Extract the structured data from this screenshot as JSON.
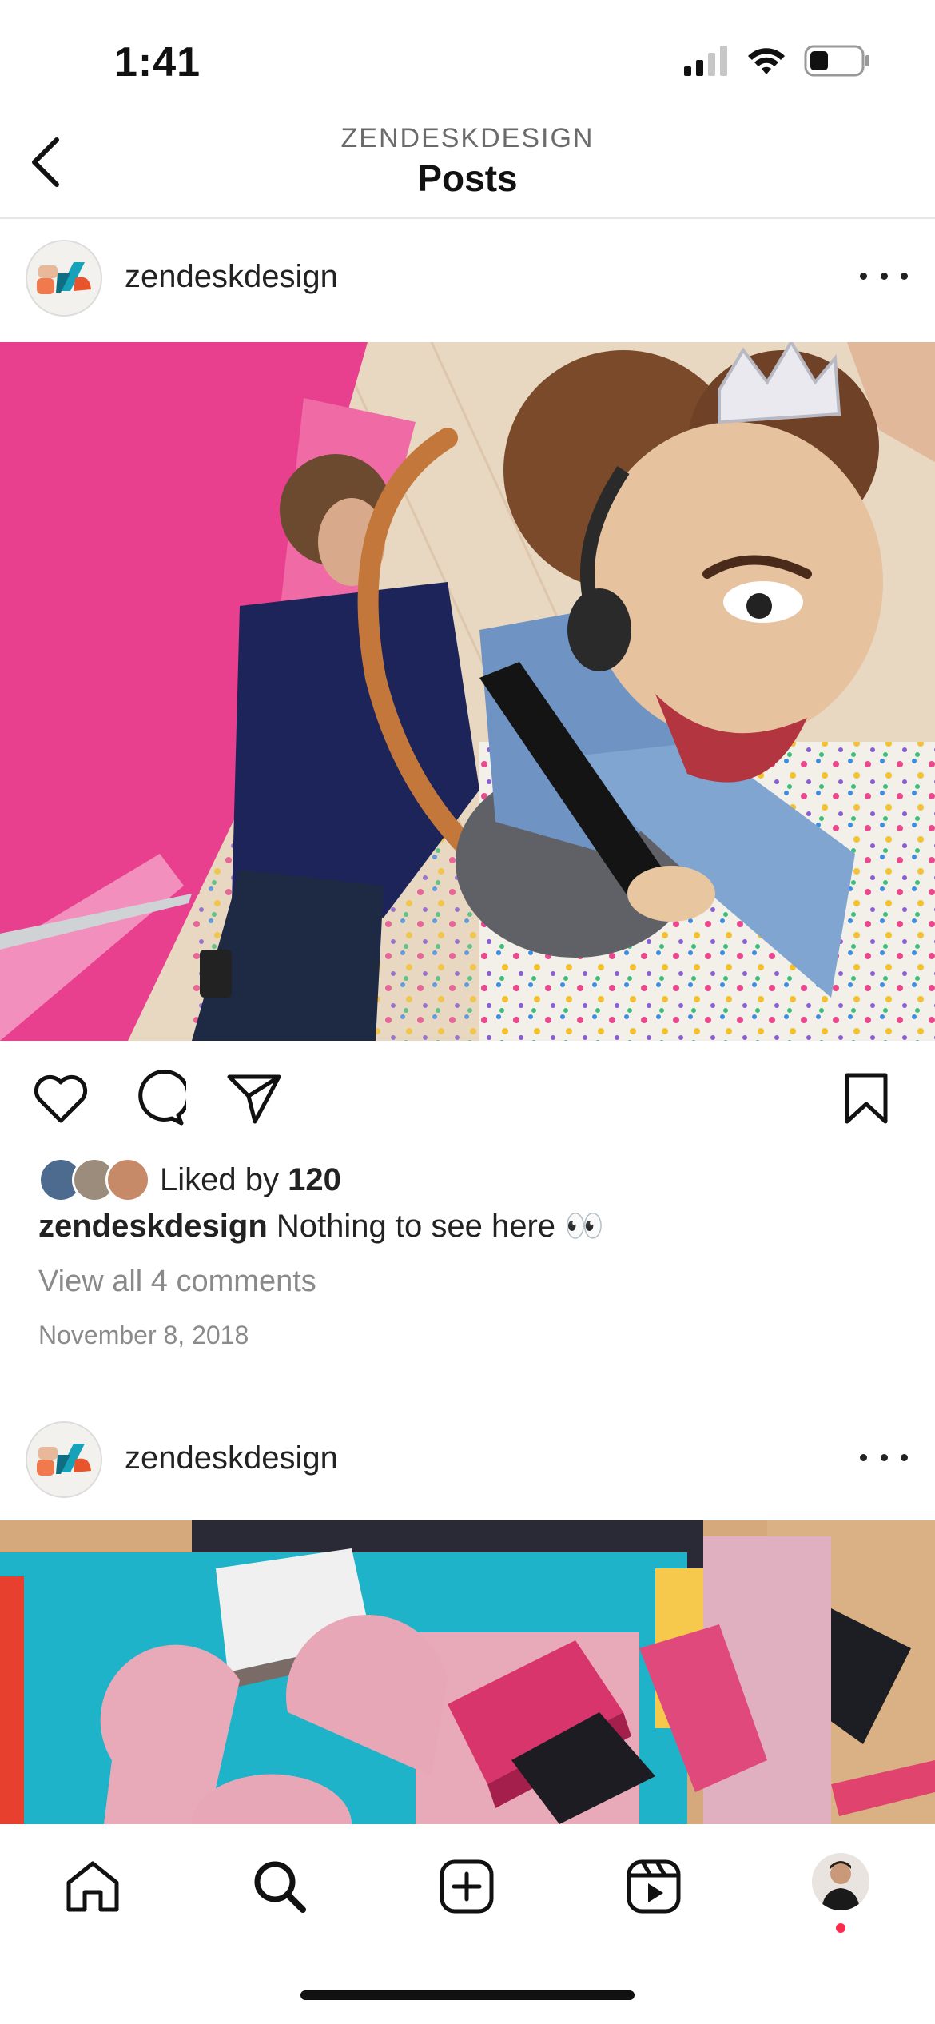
{
  "status_bar": {
    "time": "1:41"
  },
  "header": {
    "account": "ZENDESKDESIGN",
    "title": "Posts"
  },
  "posts": [
    {
      "username": "zendeskdesign",
      "likes_label": "Liked by",
      "likes_count": "120",
      "caption_user": "zendeskdesign",
      "caption_text": "Nothing to see here 👀",
      "view_comments": "View all 4 comments",
      "date": "November 8, 2018"
    },
    {
      "username": "zendeskdesign"
    }
  ],
  "icons": {
    "back": "chevron-left-icon",
    "more": "more-horizontal-icon",
    "like": "heart-icon",
    "comment": "comment-icon",
    "share": "send-icon",
    "save": "bookmark-icon",
    "nav": [
      "home-icon",
      "search-icon",
      "plus-square-icon",
      "reels-icon",
      "profile-avatar"
    ]
  },
  "colors": {
    "notification_dot": "#ff2b4d",
    "secondary_text": "#8a8a8a"
  }
}
